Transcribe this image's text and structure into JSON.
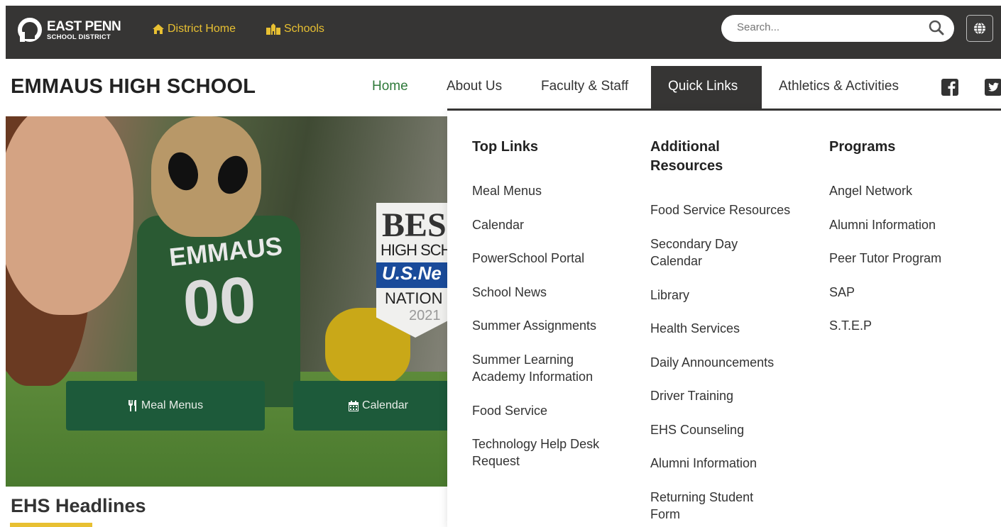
{
  "topbar": {
    "logo_line1": "EAST PENN",
    "logo_line2": "SCHOOL DISTRICT",
    "district_home": "District Home",
    "schools": "Schools",
    "search_placeholder": "Search...",
    "accent_color": "#e8c032",
    "bar_color": "#363534"
  },
  "header": {
    "school_name": "EMMAUS HIGH SCHOOL"
  },
  "nav": {
    "items": [
      "Home",
      "About Us",
      "Faculty & Staff",
      "Quick Links",
      "Athletics & Activities"
    ],
    "active": "Quick Links",
    "current_page": "Home",
    "social": [
      "facebook-icon",
      "twitter-icon"
    ]
  },
  "hero": {
    "jersey_text": "EMMAUS",
    "jersey_number": "00",
    "badge": {
      "line1": "BES",
      "line2": "HIGH SCH",
      "line3": "U.S.Ne",
      "line4": "NATION",
      "line5": "2021"
    },
    "buttons": [
      {
        "label": "Meal Menus",
        "icon": "utensils-icon"
      },
      {
        "label": "Calendar",
        "icon": "calendar-icon"
      }
    ],
    "button_color": "#1d5a3a"
  },
  "headlines": {
    "title": "EHS Headlines"
  },
  "dropdown": {
    "columns": [
      {
        "heading": "Top Links",
        "links": [
          "Meal Menus",
          "Calendar",
          "PowerSchool Portal",
          "School News",
          "Summer Assignments",
          "Summer Learning\nAcademy Information",
          "Food Service",
          "Technology Help Desk\nRequest"
        ]
      },
      {
        "heading": "Additional\nResources",
        "links": [
          "Food Service Resources",
          "Secondary Day\nCalendar",
          "Library",
          "Health Services",
          "Daily Announcements",
          "Driver Training",
          "EHS Counseling",
          "Alumni Information",
          "Returning Student\nForm"
        ]
      },
      {
        "heading": "Programs",
        "links": [
          "Angel Network",
          "Alumni Information",
          "Peer Tutor Program",
          "SAP",
          "S.T.E.P"
        ]
      }
    ]
  }
}
